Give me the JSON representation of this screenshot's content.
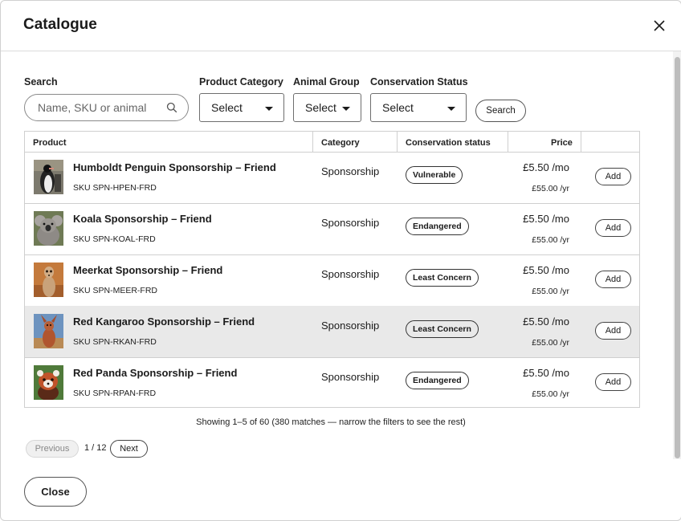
{
  "dialog": {
    "title": "Catalogue"
  },
  "filters": {
    "search_label": "Search",
    "search_placeholder": "Name, SKU or animal",
    "category_label": "Product Category",
    "category_value": "Select",
    "animal_label": "Animal Group",
    "animal_value": "Select",
    "status_label": "Conservation Status",
    "status_value": "Select",
    "search_button": "Search"
  },
  "table": {
    "headers": [
      "Product",
      "Category",
      "Conservation status",
      "Price",
      ""
    ],
    "add_label": "Add",
    "rows": [
      {
        "name": "Humboldt Penguin Sponsorship – Friend",
        "sku": "SKU SPN-HPEN-FRD",
        "category": "Sponsorship",
        "status": "Vulnerable",
        "price_monthly": "£5.50 /mo",
        "price_yearly": "£55.00 /yr",
        "image": "penguin-image"
      },
      {
        "name": "Koala Sponsorship – Friend",
        "sku": "SKU SPN-KOAL-FRD",
        "category": "Sponsorship",
        "status": "Endangered",
        "price_monthly": "£5.50 /mo",
        "price_yearly": "£55.00 /yr",
        "image": "koala-image"
      },
      {
        "name": "Meerkat Sponsorship – Friend",
        "sku": "SKU SPN-MEER-FRD",
        "category": "Sponsorship",
        "status": "Least Concern",
        "price_monthly": "£5.50 /mo",
        "price_yearly": "£55.00 /yr",
        "image": "meerkat-image"
      },
      {
        "name": "Red Kangaroo Sponsorship – Friend",
        "sku": "SKU SPN-RKAN-FRD",
        "category": "Sponsorship",
        "status": "Least Concern",
        "price_monthly": "£5.50 /mo",
        "price_yearly": "£55.00 /yr",
        "image": "kangaroo-image",
        "highlighted": true
      },
      {
        "name": "Red Panda Sponsorship – Friend",
        "sku": "SKU SPN-RPAN-FRD",
        "category": "Sponsorship",
        "status": "Endangered",
        "price_monthly": "£5.50 /mo",
        "price_yearly": "£55.00 /yr",
        "image": "red-panda-image"
      }
    ]
  },
  "footer": {
    "showing": "Showing 1–5 of 60 (380 matches — narrow the filters to see the rest)",
    "previous": "Previous",
    "page_info": "1 / 12",
    "next": "Next",
    "close": "Close"
  },
  "icons": {
    "close": "close-icon",
    "search": "search-icon",
    "caret": "caret-down-icon"
  }
}
